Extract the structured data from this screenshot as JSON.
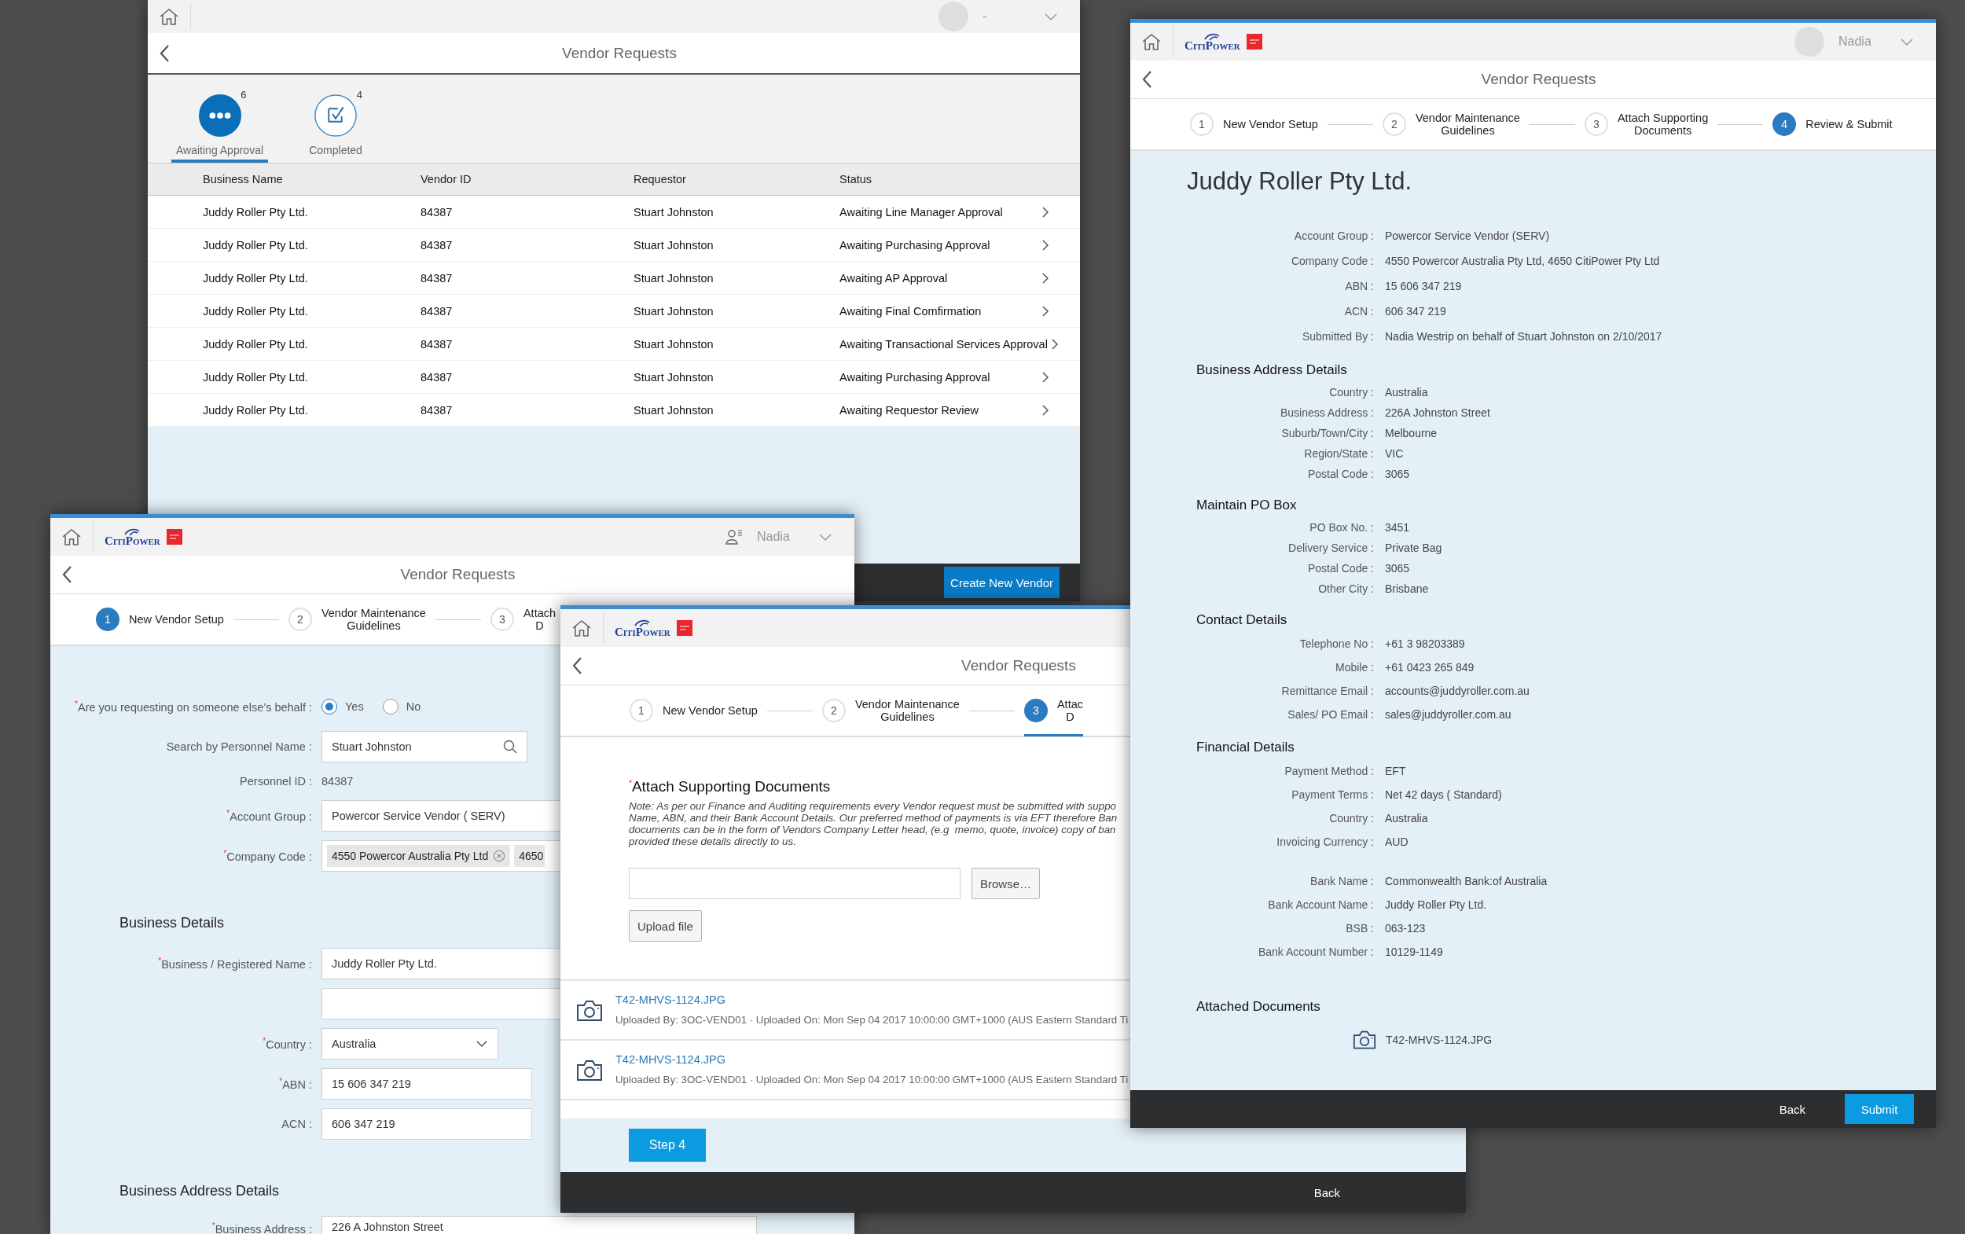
{
  "windows": [
    {
      "kind": "requests",
      "user": "-",
      "title": "Vendor Requests",
      "tabs": [
        {
          "label": "Awaiting Approval",
          "count": "6",
          "selected": true
        },
        {
          "label": "Completed",
          "count": "4",
          "selected": false
        }
      ],
      "table": {
        "columns": [
          "Business Name",
          "Vendor ID",
          "Requestor",
          "Status"
        ],
        "rows": [
          [
            "Juddy Roller Pty Ltd.",
            "84387",
            "Stuart Johnston",
            "Awaiting Line Manager Approval"
          ],
          [
            "Juddy Roller Pty Ltd.",
            "84387",
            "Stuart Johnston",
            "Awaiting Purchasing Approval"
          ],
          [
            "Juddy Roller Pty Ltd.",
            "84387",
            "Stuart Johnston",
            "Awaiting AP Approval"
          ],
          [
            "Juddy Roller Pty Ltd.",
            "84387",
            "Stuart Johnston",
            "Awaiting Final Comfirmation"
          ],
          [
            "Juddy Roller Pty Ltd.",
            "84387",
            "Stuart Johnston",
            "Awaiting Transactional Services Approval"
          ],
          [
            "Juddy Roller Pty Ltd.",
            "84387",
            "Stuart Johnston",
            "Awaiting Purchasing Approval"
          ],
          [
            "Juddy Roller Pty Ltd.",
            "84387",
            "Stuart Johnston",
            "Awaiting Requestor Review"
          ]
        ]
      },
      "footer_button": "Create New Vendor"
    },
    {
      "kind": "setup",
      "logo": "CitiPower",
      "user": "Nadia",
      "title": "Vendor Requests",
      "steps": [
        {
          "number": "1",
          "label": "New Vendor Setup",
          "selected": true
        },
        {
          "number": "2",
          "label": "Vendor Maintenance\nGuidelines",
          "selected": false
        },
        {
          "number": "3",
          "label": "Attach\nD",
          "selected": false
        }
      ],
      "form": [
        {
          "kind": "radio",
          "label": "$^{*}$Are you requesting on someone else’s behalf :",
          "options": [
            {
              "label": "Yes",
              "selected": true
            },
            {
              "label": "No",
              "selected": false
            }
          ]
        },
        {
          "kind": "search",
          "label": "Search by Personnel Name :",
          "value": "Stuart Johnston"
        },
        {
          "kind": "text",
          "label": "Personnel ID :",
          "value": "84387"
        },
        {
          "kind": "field",
          "label": "$^{*}$Account Group :",
          "value": "Powercor Service Vendor ( SERV)"
        },
        {
          "kind": "chips",
          "label": "$^{*}$Company Code :",
          "chips": [
            "4550 Powercor Australia Pty Ltd",
            "4650"
          ]
        },
        {
          "kind": "heading",
          "label": "Business Details"
        },
        {
          "kind": "field",
          "label": "$^{*}$Business / Registered Name :",
          "value": "Juddy Roller Pty Ltd."
        },
        {
          "kind": "blank"
        },
        {
          "kind": "select",
          "label": "$^{*}$Country :",
          "value": "Australia"
        },
        {
          "kind": "short",
          "label": "$^{*}$ABN :",
          "value": "15 606 347 219"
        },
        {
          "kind": "short",
          "label": "ACN :",
          "value": "606 347 219"
        },
        {
          "kind": "heading",
          "label": "Business Address Details"
        },
        {
          "kind": "address",
          "label": "$^{*}$Business Address :",
          "value": "226 A  Johnston Street"
        }
      ]
    },
    {
      "kind": "attach",
      "logo": "CitiPower",
      "title": "Vendor Requests",
      "steps": [
        {
          "number": "1",
          "label": "New Vendor Setup",
          "selected": false
        },
        {
          "number": "2",
          "label": "Vendor Maintenance\nGuidelines",
          "selected": false
        },
        {
          "number": "3",
          "label": "Attac\nD",
          "selected": true
        }
      ],
      "heading": "$^{*}$Attach Supporting Documents",
      "note": "Note: As per our Finance and Auditing requirements every Vendor request must be submitted with suppo\nName, ABN, and their Bank Account Details. Our preferred method of payments is via EFT therefore Ban\ndocuments can be in the form of Vendors Company Letter head, (e.g  memo, quote, invoice) copy of ban\nprovided these details directly to us.",
      "browse_button": "Browse…",
      "upload_button": "Upload file",
      "files": [
        {
          "name": "T42-MHVS-1124.JPG",
          "meta": "Uploaded By: 3OC-VEND01 · Uploaded On: Mon Sep 04 2017 10:00:00 GMT+1000 (AUS Eastern Standard Ti"
        },
        {
          "name": "T42-MHVS-1124.JPG",
          "meta": "Uploaded By: 3OC-VEND01 · Uploaded On: Mon Sep 04 2017 10:00:00 GMT+1000 (AUS Eastern Standard Ti"
        }
      ],
      "next_button": "Step 4",
      "footer_button": "Back"
    },
    {
      "kind": "review",
      "logo": "CitiPower",
      "user": "Nadia",
      "title": "Vendor Requests",
      "steps": [
        {
          "number": "1",
          "label": "New Vendor Setup",
          "selected": false
        },
        {
          "number": "2",
          "label": "Vendor Maintenance\nGuidelines",
          "selected": false
        },
        {
          "number": "3",
          "label": "Attach Supporting\nDocuments",
          "selected": false
        },
        {
          "number": "4",
          "label": "Review & Submit",
          "selected": true
        }
      ],
      "vendor_name": "Juddy Roller Pty Ltd.",
      "summary": [
        {
          "label": "Account Group :",
          "value": "Powercor Service Vendor (SERV)"
        },
        {
          "label": "Company Code :",
          "value": "4550 Powercor Australia Pty Ltd, 4650 CitiPower Pty Ltd"
        },
        {
          "label": "ABN :",
          "value": "15 606 347 219"
        },
        {
          "label": "ACN :",
          "value": "606 347 219"
        },
        {
          "label": "Submitted By :",
          "value": "Nadia Westrip on behalf of Stuart Johnston on 2/10/2017"
        }
      ],
      "sections": [
        {
          "title": "Business Address Details",
          "rows": [
            {
              "label": "Country :",
              "value": "Australia"
            },
            {
              "label": "Business Address :",
              "value": "226A Johnston Street"
            },
            {
              "label": "Suburb/Town/City :",
              "value": "Melbourne"
            },
            {
              "label": "Region/State :",
              "value": "VIC"
            },
            {
              "label": "Postal Code :",
              "value": "3065"
            }
          ]
        },
        {
          "title": "Maintain PO Box",
          "rows": [
            {
              "label": "PO Box No. :",
              "value": "3451"
            },
            {
              "label": "Delivery Service :",
              "value": "Private Bag"
            },
            {
              "label": "Postal Code :",
              "value": "3065"
            },
            {
              "label": "Other City :",
              "value": "Brisbane"
            }
          ]
        },
        {
          "title": "Contact Details",
          "rows": [
            {
              "label": "Telephone No :",
              "value": "+61 3 98203389"
            },
            {
              "label": "Mobile :",
              "value": "+61 0423 265 849"
            },
            {
              "label": "Remittance Email :",
              "value": "accounts@juddyroller.com.au"
            },
            {
              "label": "Sales/ PO Email :",
              "value": "sales@juddyroller.com.au"
            }
          ]
        },
        {
          "title": "Financial Details",
          "rows": [
            {
              "label": "Payment Method :",
              "value": "EFT"
            },
            {
              "label": "Payment Terms :",
              "value": "Net 42 days ( Standard)"
            },
            {
              "label": "Country :",
              "value": "Australia"
            },
            {
              "label": "Invoicing Currency :",
              "value": "AUD"
            }
          ]
        },
        {
          "rows": [
            {
              "label": "Bank Name :",
              "value": "Commonwealth Bank:of Australia"
            },
            {
              "label": "Bank Account Name :",
              "value": "Juddy Roller Pty Ltd."
            },
            {
              "label": "BSB :",
              "value": "063-123"
            },
            {
              "label": "Bank Account Number :",
              "value": "10129-1149"
            }
          ]
        }
      ],
      "attachments": {
        "title": "Attached Documents",
        "files": [
          "T42-MHVS-1124.JPG"
        ]
      },
      "buttons": [
        {
          "label": "Back",
          "kind": "plain"
        },
        {
          "label": "Submit",
          "kind": "primary"
        }
      ]
    }
  ]
}
